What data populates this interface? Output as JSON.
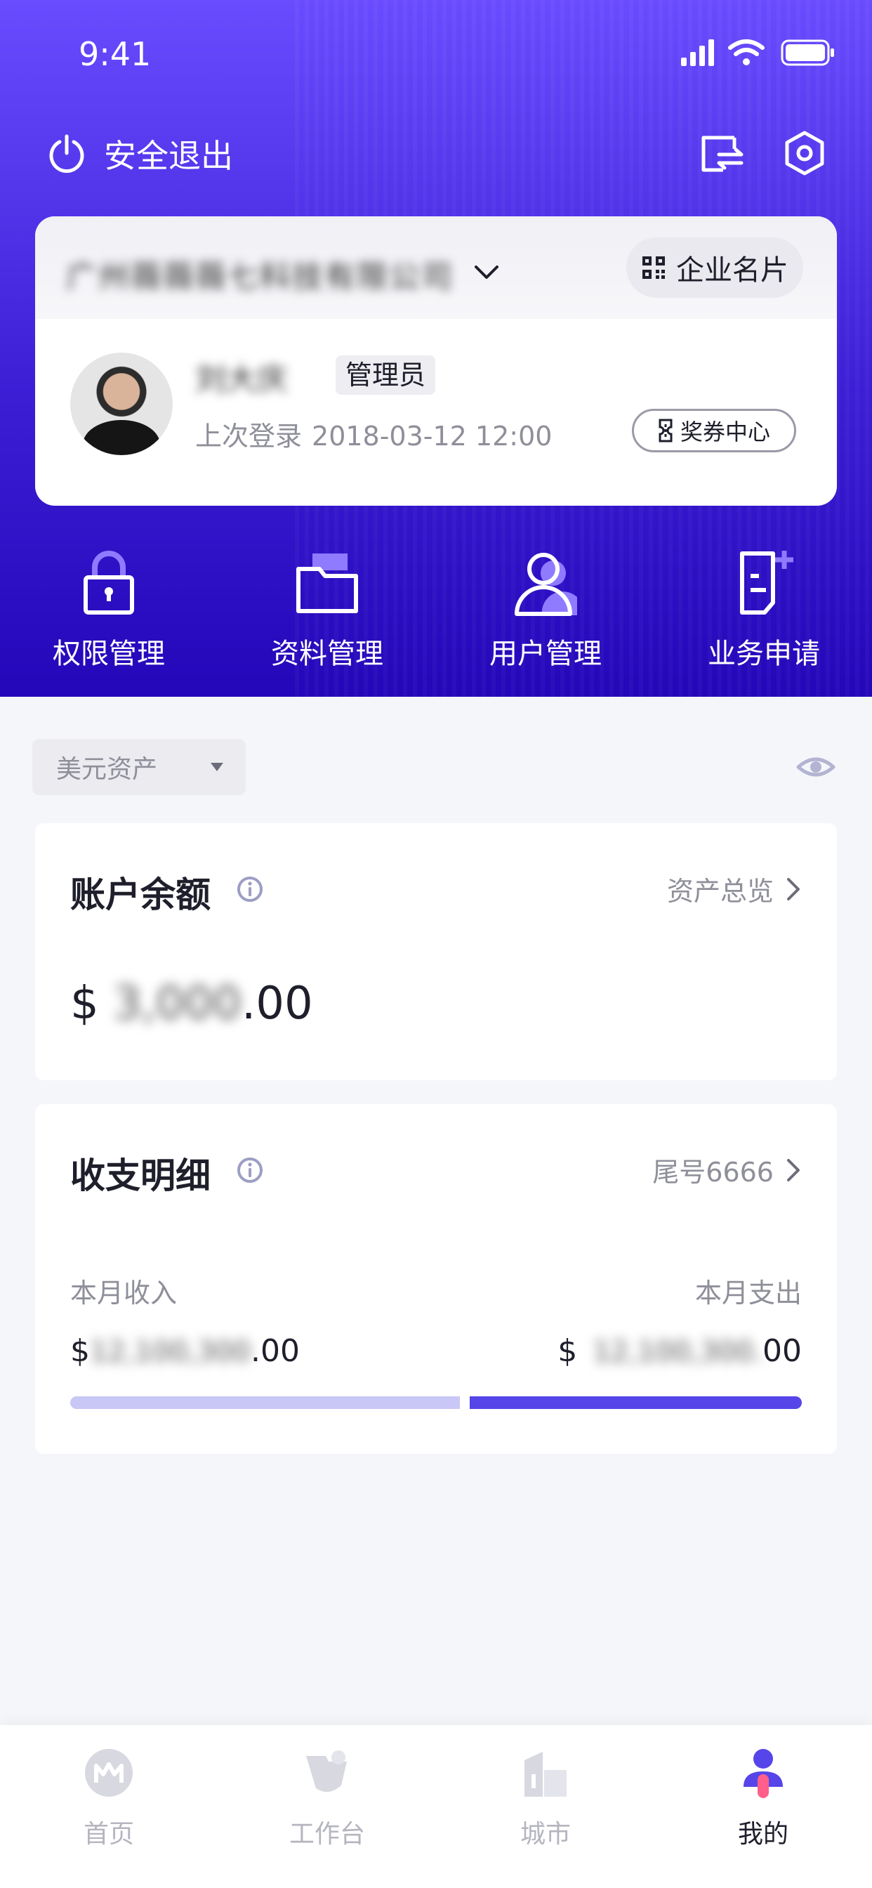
{
  "status_bar": {
    "time": "9:41"
  },
  "header": {
    "logout_label": "安全退出",
    "icons": [
      "switch-account-icon",
      "settings-hex-icon"
    ]
  },
  "company_card": {
    "company_name": "广州薇薇薇七科技有限公司",
    "business_card_label": "企业名片",
    "user_name": "刘大庆",
    "role": "管理员",
    "last_login_label": "上次登录",
    "last_login_time": "2018-03-12 12:00",
    "coupon_label": "奖券中心"
  },
  "quick_actions": [
    {
      "label": "权限管理",
      "icon": "lock-icon"
    },
    {
      "label": "资料管理",
      "icon": "folder-icon"
    },
    {
      "label": "用户管理",
      "icon": "user-icon"
    },
    {
      "label": "业务申请",
      "icon": "document-add-icon"
    }
  ],
  "asset_select": {
    "value": "美元资产"
  },
  "balance_card": {
    "title": "账户余额",
    "link_label": "资产总览",
    "currency": "$",
    "amount_masked": "3,000",
    "decimals": ".00"
  },
  "transactions_card": {
    "title": "收支明细",
    "link_label": "尾号6666",
    "income_label": "本月收入",
    "expense_label": "本月支出",
    "income_currency": "$",
    "income_masked": "12,100,300",
    "income_decimals": ".00",
    "expense_currency": "$",
    "expense_masked": "12,100,300.",
    "expense_decimals": "00",
    "income_share": 0.54,
    "colors": {
      "income": "#c9c7f5",
      "expense": "#5645e8"
    }
  },
  "tab_bar": [
    {
      "label": "首页",
      "icon": "home-logo-icon",
      "active": false
    },
    {
      "label": "工作台",
      "icon": "workbench-icon",
      "active": false
    },
    {
      "label": "城市",
      "icon": "city-icon",
      "active": false
    },
    {
      "label": "我的",
      "icon": "profile-icon",
      "active": true
    }
  ],
  "theme": {
    "primary": "#5645e8",
    "header_top": "#6a4cff",
    "header_bottom": "#2407b9"
  }
}
